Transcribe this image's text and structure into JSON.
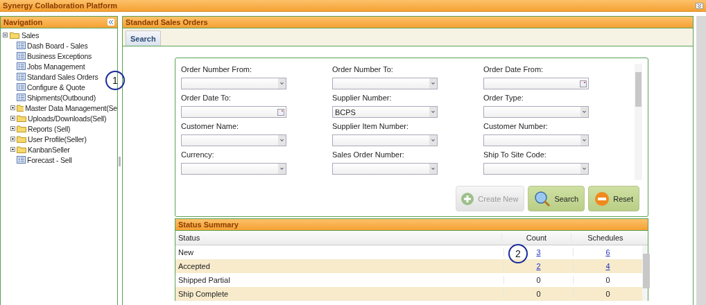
{
  "app_title": "Synergy Collaboration Platform",
  "navigation": {
    "title": "Navigation",
    "tree": [
      {
        "label": "Sales",
        "kind": "folder",
        "expanded": true,
        "children": [
          {
            "label": "Dash Board - Sales",
            "kind": "page"
          },
          {
            "label": "Business Exceptions",
            "kind": "page"
          },
          {
            "label": "Jobs Management",
            "kind": "page"
          },
          {
            "label": "Standard Sales Orders",
            "kind": "page"
          },
          {
            "label": "Configure & Quote",
            "kind": "page"
          },
          {
            "label": "Shipments(Outbound)",
            "kind": "page"
          },
          {
            "label": "Master Data Management(Se",
            "kind": "folder",
            "expanded": false
          },
          {
            "label": "Uploads/Downloads(Sell)",
            "kind": "folder",
            "expanded": false
          },
          {
            "label": "Reports (Sell)",
            "kind": "folder",
            "expanded": false
          },
          {
            "label": "User Profile(Seller)",
            "kind": "folder",
            "expanded": false
          },
          {
            "label": "KanbanSeller",
            "kind": "folder",
            "expanded": false
          },
          {
            "label": "Forecast - Sell",
            "kind": "page"
          }
        ]
      }
    ]
  },
  "main": {
    "title": "Standard Sales Orders",
    "tabs": [
      {
        "label": "Search",
        "selected": true
      }
    ],
    "fields": [
      {
        "label": "Order Number From:",
        "kind": "select"
      },
      {
        "label": "Order Number To:",
        "kind": "select"
      },
      {
        "label": "Order Date From:",
        "kind": "date"
      },
      {
        "label": "Order Date To:",
        "kind": "date"
      },
      {
        "label": "Supplier Number:",
        "kind": "select",
        "value": "BCPS"
      },
      {
        "label": "Order Type:",
        "kind": "select"
      },
      {
        "label": "Customer Name:",
        "kind": "select"
      },
      {
        "label": "Supplier Item Number:",
        "kind": "select"
      },
      {
        "label": "Customer Number:",
        "kind": "select"
      },
      {
        "label": "Currency:",
        "kind": "select"
      },
      {
        "label": "Sales Order Number:",
        "kind": "select"
      },
      {
        "label": "Ship To Site Code:",
        "kind": "select"
      }
    ],
    "buttons": [
      {
        "label": "Create New",
        "kind": "create",
        "disabled": true
      },
      {
        "label": "Search",
        "kind": "search",
        "disabled": false
      },
      {
        "label": "Reset",
        "kind": "reset",
        "disabled": false
      }
    ],
    "status_summary": {
      "title": "Status Summary",
      "columns": [
        "Status",
        "Count",
        "Schedules"
      ],
      "rows": [
        {
          "status": "New",
          "count": {
            "text": "3",
            "link": true
          },
          "schedules": {
            "text": "6",
            "link": true
          }
        },
        {
          "status": "Accepted",
          "count": {
            "text": "2",
            "link": true
          },
          "schedules": {
            "text": "4",
            "link": true
          }
        },
        {
          "status": "Shipped Partial",
          "count": {
            "text": "0",
            "link": false
          },
          "schedules": {
            "text": "0",
            "link": false
          }
        },
        {
          "status": "Ship Complete",
          "count": {
            "text": "0",
            "link": false
          },
          "schedules": {
            "text": "0",
            "link": false
          }
        }
      ]
    }
  },
  "callouts": [
    {
      "text": "1"
    },
    {
      "text": "2"
    }
  ]
}
